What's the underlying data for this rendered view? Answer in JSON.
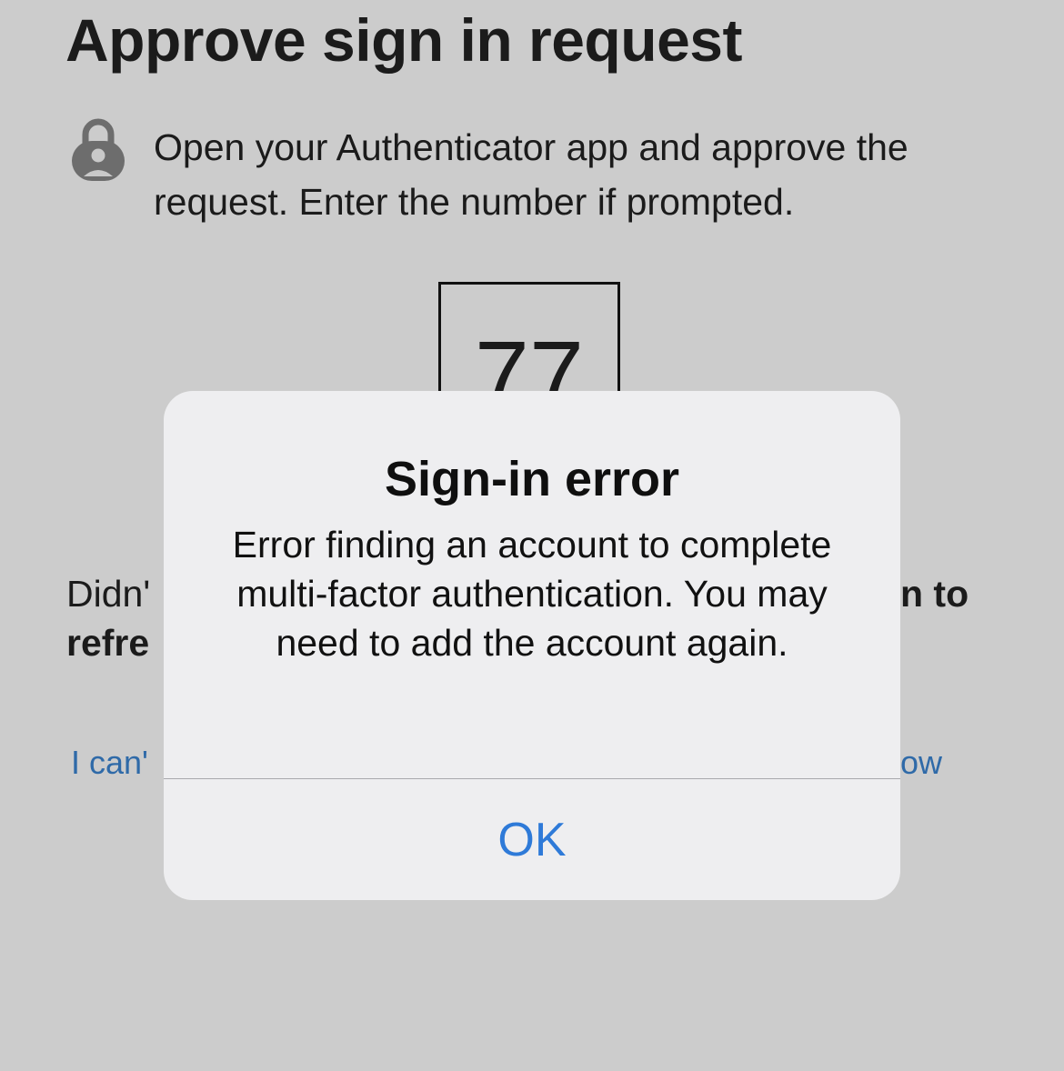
{
  "page": {
    "title": "Approve sign in request",
    "instruction": "Open your Authenticator app and approve the request. Enter the number if prompted.",
    "number": "77",
    "partial_text_left_line1": "Didn'",
    "partial_text_left_line2": "refre",
    "partial_text_right": "n to",
    "partial_link_left": "I can'",
    "partial_link_right": "ow"
  },
  "dialog": {
    "title": "Sign-in error",
    "message": "Error finding an account to complete multi-factor authentication. You may need to add the account again.",
    "ok_label": "OK"
  },
  "icons": {
    "lock": "lock-icon"
  },
  "colors": {
    "background": "#cccccc",
    "dialog_background": "#eeeef0",
    "link": "#2f6aa8",
    "ok_button": "#2e7ad8"
  }
}
